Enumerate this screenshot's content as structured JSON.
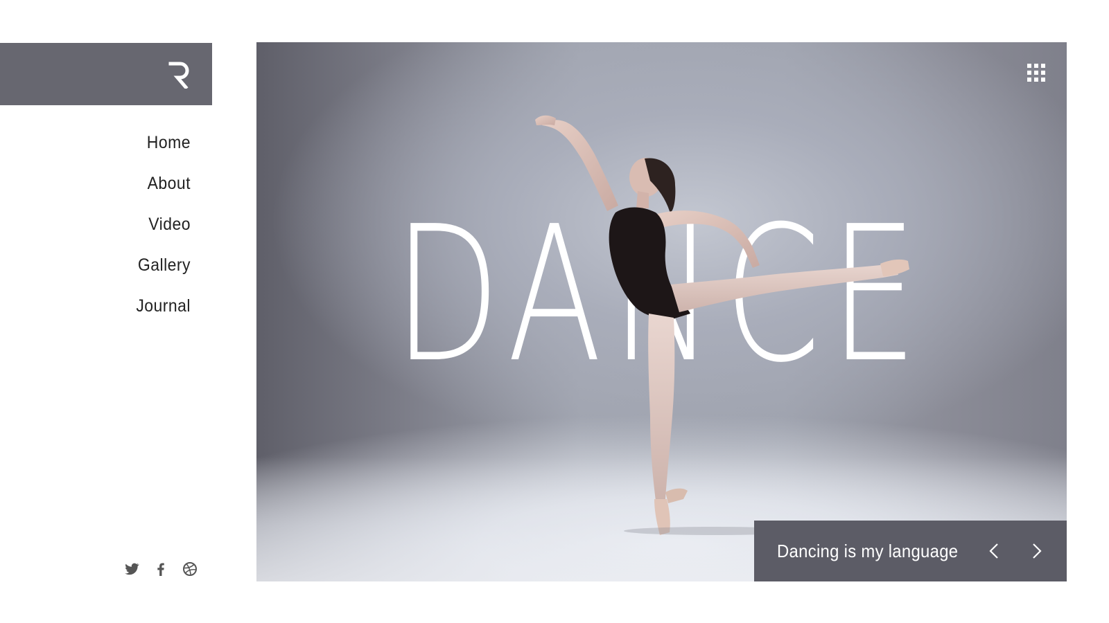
{
  "sidebar": {
    "logo": {
      "icon": "r-logo-icon",
      "bg_color": "#676770"
    },
    "nav": [
      {
        "label": "Home"
      },
      {
        "label": "About"
      },
      {
        "label": "Video"
      },
      {
        "label": "Gallery"
      },
      {
        "label": "Journal"
      }
    ],
    "social": [
      {
        "icon": "twitter-icon"
      },
      {
        "icon": "facebook-icon"
      },
      {
        "icon": "dribbble-icon"
      }
    ]
  },
  "hero": {
    "headline": "DANCE",
    "menu_icon": "grid-menu-icon",
    "caption": "Dancing is my language",
    "prev_icon": "chevron-left-icon",
    "next_icon": "chevron-right-icon",
    "caption_bg_color": "#5c5c66"
  }
}
